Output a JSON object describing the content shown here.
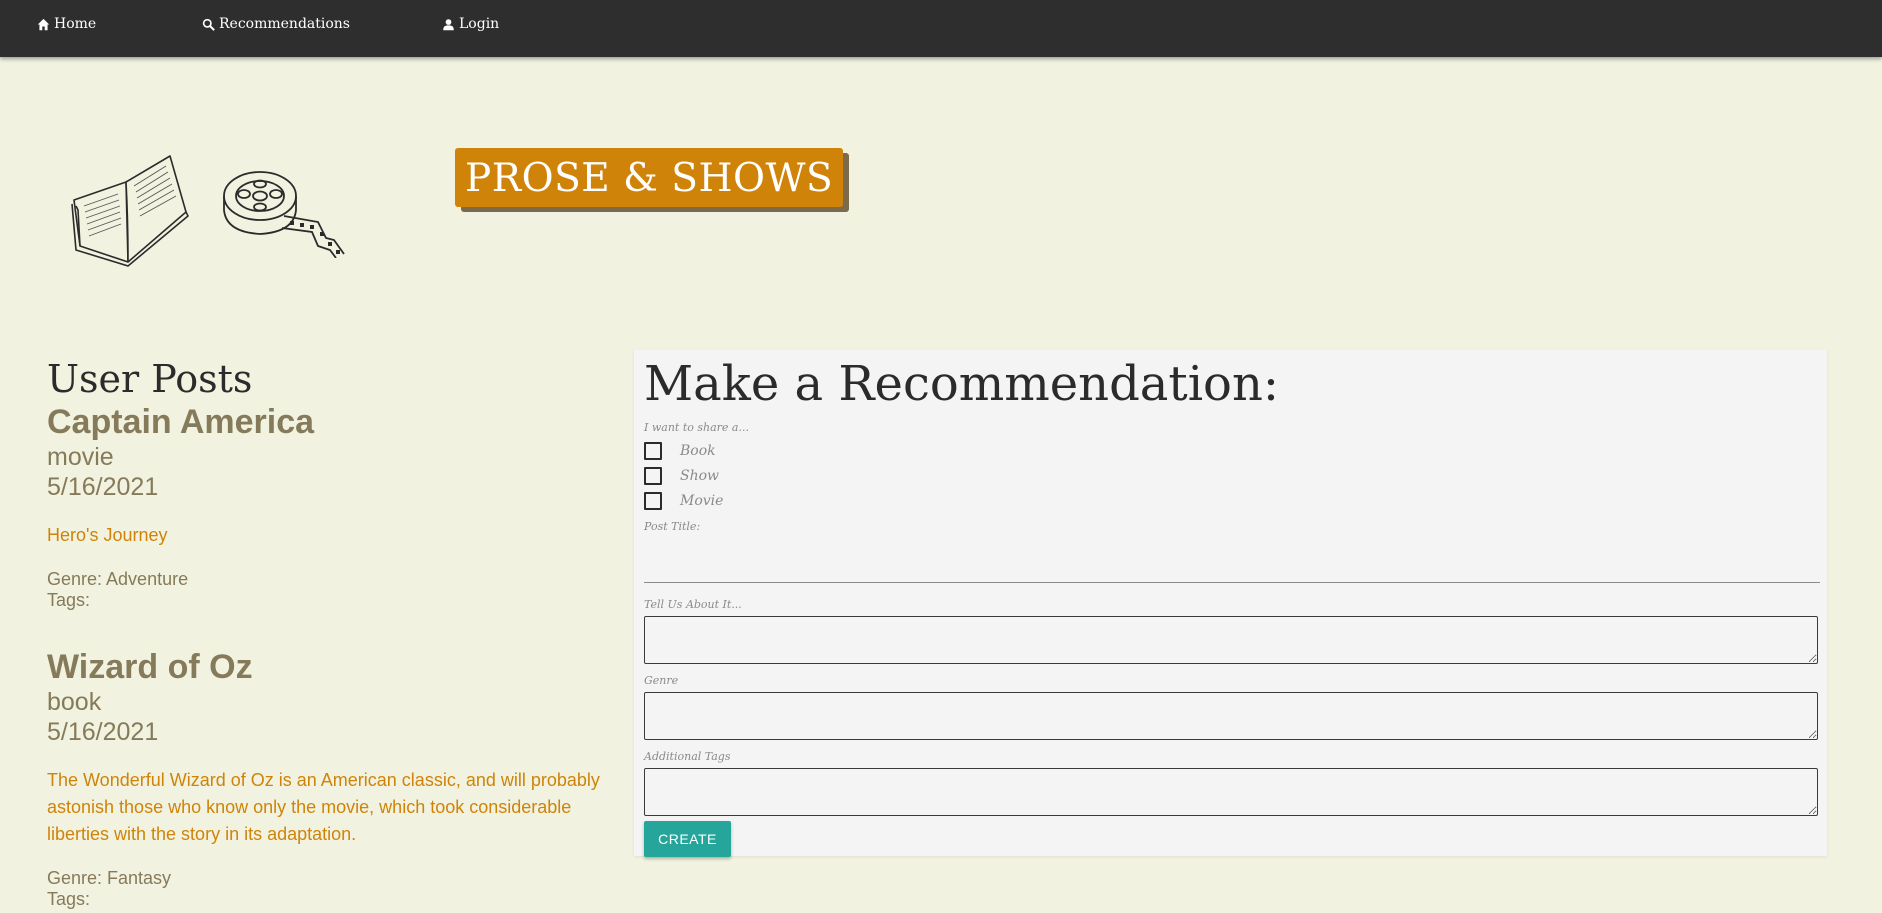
{
  "nav": {
    "home": {
      "label": "Home",
      "icon": "home-icon"
    },
    "recommendations": {
      "label": "Recommendations",
      "icon": "search-icon"
    },
    "login": {
      "label": "Login",
      "icon": "user-icon"
    }
  },
  "brand": {
    "title": "PROSE & SHOWS",
    "accent_color": "#cf8409"
  },
  "posts_section": {
    "heading": "User Posts",
    "posts": [
      {
        "title": "Captain America",
        "type": "movie",
        "date": "5/16/2021",
        "body": "Hero's Journey",
        "genre": "Genre: Adventure",
        "tags": "Tags:"
      },
      {
        "title": "Wizard of Oz",
        "type": "book",
        "date": "5/16/2021",
        "body": "The Wonderful Wizard of Oz is an American classic, and will probably astonish those who know only the movie, which took considerable liberties with the story in its adaptation.",
        "genre": "Genre: Fantasy",
        "tags": "Tags:"
      }
    ]
  },
  "form": {
    "heading": "Make a Recommendation:",
    "share_label": "I want to share a...",
    "options": [
      "Book",
      "Show",
      "Movie"
    ],
    "post_title_label": "Post Title:",
    "post_title_value": "",
    "about_label": "Tell Us About It...",
    "genre_label": "Genre",
    "tags_label": "Additional Tags",
    "submit_label": "CREATE",
    "submit_color": "#26a69a"
  }
}
